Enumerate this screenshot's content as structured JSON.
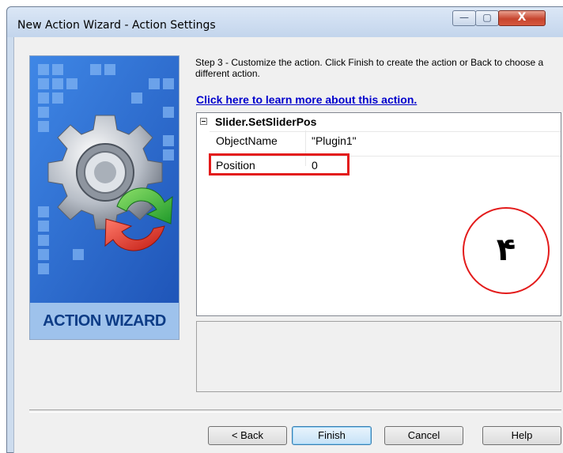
{
  "window": {
    "title": "New Action Wizard - Action Settings",
    "controls": {
      "minimize": "—",
      "maximize": "▢",
      "close": "X"
    }
  },
  "banner": {
    "label": "ACTION WIZARD",
    "icon": "gear-with-arrows-icon"
  },
  "instructions": {
    "step_text": "Step 3 - Customize the action.  Click Finish to create the action or Back to choose a different action.",
    "help_link": "Click here to learn more about this action."
  },
  "property_grid": {
    "category": "Slider.SetSliderPos",
    "properties": [
      {
        "name": "ObjectName",
        "value": "\"Plugin1\""
      },
      {
        "name": "Position",
        "value": "0"
      }
    ]
  },
  "annotation": {
    "text": "۴",
    "color": "#e31b1b"
  },
  "buttons": {
    "back": "< Back",
    "finish": "Finish",
    "cancel": "Cancel",
    "help": "Help"
  },
  "colors": {
    "title_bar": "#c3d5ec",
    "banner_blue": "#2d6bd2",
    "link": "#0000cc",
    "highlight": "#e31b1b"
  }
}
